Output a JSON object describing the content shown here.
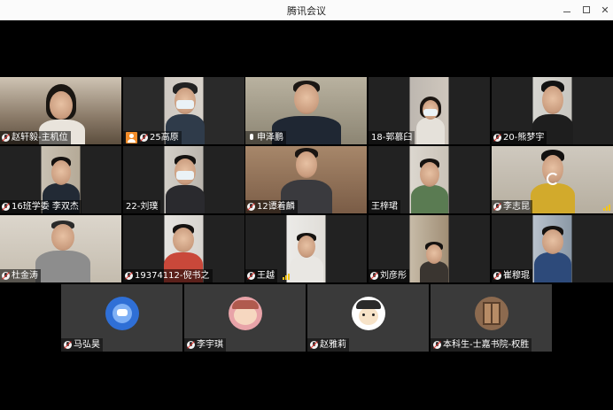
{
  "window": {
    "title": "腾讯会议"
  },
  "controls": {
    "minimize": "minimize",
    "maximize": "maximize",
    "close": "close"
  },
  "participants": [
    {
      "name": "赵轩毅-主机位",
      "mic": "muted"
    },
    {
      "name": "25高原",
      "mic": "orange"
    },
    {
      "name": "申泽鹏",
      "mic": "white"
    },
    {
      "name": "18-郭慕臼",
      "mic": "none"
    },
    {
      "name": "20-熊梦宇",
      "mic": "muted"
    },
    {
      "name": "16班学委 李双杰",
      "mic": "muted"
    },
    {
      "name": "22-刘璞",
      "mic": "none"
    },
    {
      "name": "12谭着麟",
      "mic": "muted"
    },
    {
      "name": "王梓珺",
      "mic": "none"
    },
    {
      "name": "李志昆",
      "mic": "muted",
      "signal": true,
      "loading": true
    },
    {
      "name": "杜金涛",
      "mic": "muted"
    },
    {
      "name": "19374112-倪书之",
      "mic": "muted"
    },
    {
      "name": "王越",
      "mic": "muted",
      "signal": true
    },
    {
      "name": "刘彦彤",
      "mic": "muted"
    },
    {
      "name": "崔穆琨",
      "mic": "muted"
    },
    {
      "name": "马弘昊",
      "mic": "muted",
      "avatar": "cartoon-blue"
    },
    {
      "name": "李宇琪",
      "mic": "muted",
      "avatar": "cartoon-pink"
    },
    {
      "name": "赵雅莉",
      "mic": "muted",
      "avatar": "cartoon-white"
    },
    {
      "name": "本科生-士嘉书院-权胜",
      "mic": "muted",
      "avatar": "door"
    }
  ]
}
